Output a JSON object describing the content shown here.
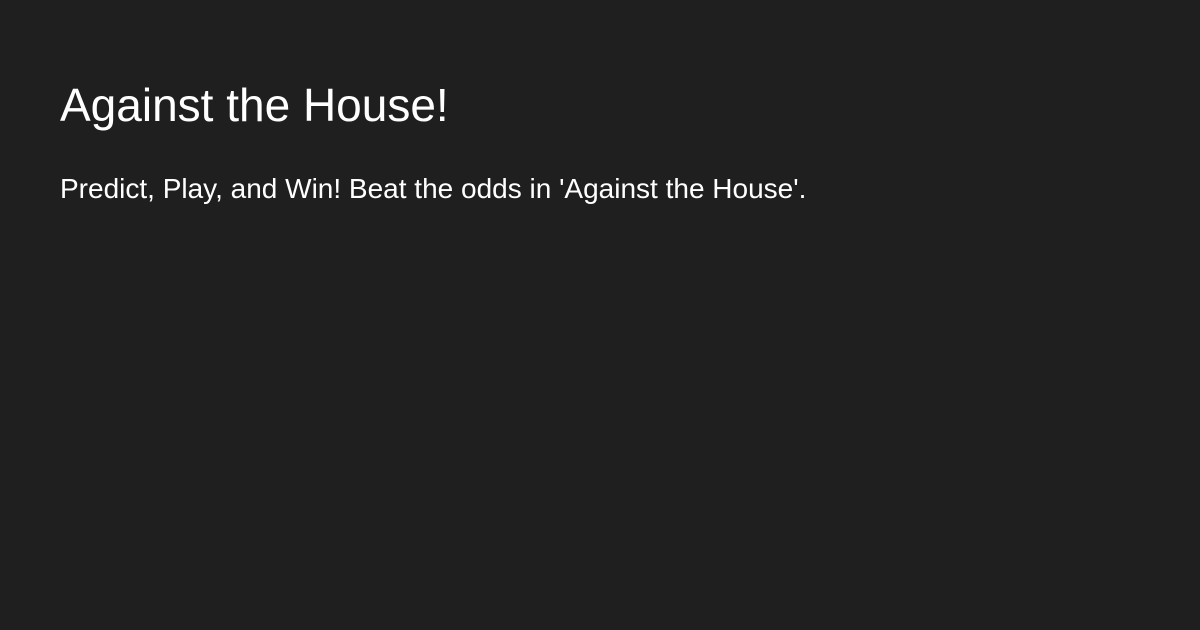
{
  "card": {
    "title": "Against the House!",
    "tagline": "Predict, Play, and Win! Beat the odds in 'Against the House'."
  },
  "colors": {
    "background": "#1f1f1f",
    "text": "#ffffff"
  }
}
